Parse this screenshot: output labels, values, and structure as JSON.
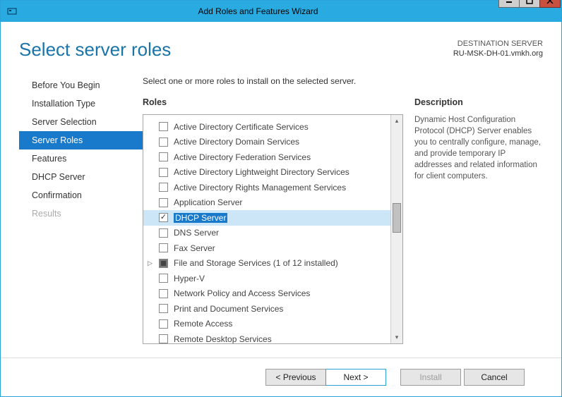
{
  "window": {
    "title": "Add Roles and Features Wizard"
  },
  "header": {
    "title": "Select server roles",
    "destination_label": "DESTINATION SERVER",
    "destination_name": "RU-MSK-DH-01.vmkh.org"
  },
  "instruction": "Select one or more roles to install on the selected server.",
  "sidebar": {
    "steps": [
      {
        "label": "Before You Begin",
        "state": "normal"
      },
      {
        "label": "Installation Type",
        "state": "normal"
      },
      {
        "label": "Server Selection",
        "state": "normal"
      },
      {
        "label": "Server Roles",
        "state": "selected"
      },
      {
        "label": "Features",
        "state": "normal"
      },
      {
        "label": "DHCP Server",
        "state": "normal"
      },
      {
        "label": "Confirmation",
        "state": "normal"
      },
      {
        "label": "Results",
        "state": "disabled"
      }
    ]
  },
  "roles": {
    "heading": "Roles",
    "items": [
      {
        "label": "Active Directory Certificate Services"
      },
      {
        "label": "Active Directory Domain Services"
      },
      {
        "label": "Active Directory Federation Services"
      },
      {
        "label": "Active Directory Lightweight Directory Services"
      },
      {
        "label": "Active Directory Rights Management Services"
      },
      {
        "label": "Application Server"
      },
      {
        "label": "DHCP Server",
        "checked": true,
        "highlight": true
      },
      {
        "label": "DNS Server"
      },
      {
        "label": "Fax Server"
      },
      {
        "label": "File and Storage Services (1 of 12 installed)",
        "partial": true,
        "expandable": true
      },
      {
        "label": "Hyper-V"
      },
      {
        "label": "Network Policy and Access Services"
      },
      {
        "label": "Print and Document Services"
      },
      {
        "label": "Remote Access"
      },
      {
        "label": "Remote Desktop Services"
      }
    ]
  },
  "description": {
    "heading": "Description",
    "text": "Dynamic Host Configuration Protocol (DHCP) Server enables you to centrally configure, manage, and provide temporary IP addresses and related information for client computers."
  },
  "buttons": {
    "previous": "< Previous",
    "next": "Next >",
    "install": "Install",
    "cancel": "Cancel"
  }
}
